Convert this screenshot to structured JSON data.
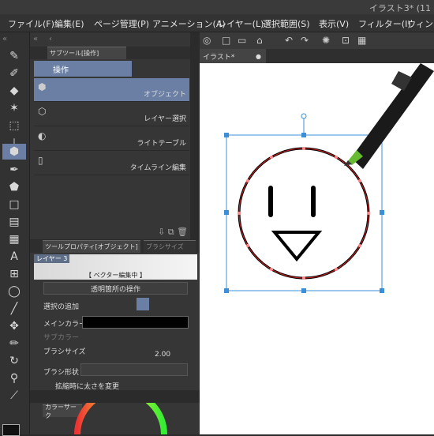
{
  "title": "イラスト3* (11",
  "menu": [
    "ファイル(F)",
    "編集(E)",
    "ページ管理(P)",
    "アニメーション(A)",
    "レイヤー(L)",
    "選択範囲(S)",
    "表示(V)",
    "フィルター(I)",
    "ウィンド"
  ],
  "subtool_panel": {
    "tab_label": "サブツール[操作]",
    "group_label": "操作",
    "items": [
      {
        "label": "オブジェクト",
        "selected": true
      },
      {
        "label": "レイヤー選択",
        "selected": false
      },
      {
        "label": "ライトテーブル",
        "selected": false
      },
      {
        "label": "タイムライン編集",
        "selected": false
      }
    ]
  },
  "tool_property": {
    "tab_label": "ツールプロパティ[オブジェクト]",
    "brush_tab": "ブラシサイズ",
    "layer_label": "レイヤー 3",
    "edit_label": "【 ベクター編集中 】",
    "transparent_op": "透明箇所の操作",
    "select_add": "選択の追加",
    "main_color_label": "メインカラー",
    "sub_color_label": "サブカラー",
    "brush_size_label": "ブラシサイズ",
    "brush_size_value": "2.00",
    "brush_shape_label": "ブラシ形状",
    "scale_label": "拡縮時に太さを変更"
  },
  "color_panel_tab": "カラーサーク",
  "canvas": {
    "doc_tab": "イラスト*"
  },
  "colors": {
    "accent": "#6a7fa3",
    "panel": "#363636",
    "handle": "#3b8fd9"
  }
}
